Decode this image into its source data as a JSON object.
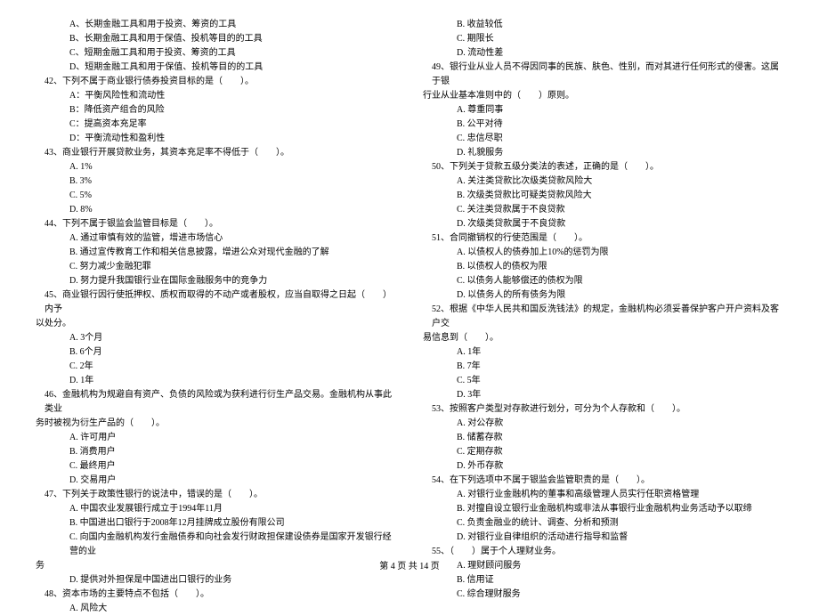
{
  "left": {
    "pre_opts": [
      "A、长期金融工具和用于投资、筹资的工具",
      "B、长期金融工具和用于保值、投机等目的的工具",
      "C、短期金融工具和用于投资、筹资的工具",
      "D、短期金融工具和用于保值、投机等目的的工具"
    ],
    "q42": "42、下列不属于商业银行债券投资目标的是（　　）。",
    "q42_opts": [
      "A：平衡风险性和流动性",
      "B：降低资产组合的风险",
      "C：提高资本充足率",
      "D：平衡流动性和盈利性"
    ],
    "q43": "43、商业银行开展贷款业务，其资本充足率不得低于（　　）。",
    "q43_opts": [
      "A. 1%",
      "B. 3%",
      "C. 5%",
      "D. 8%"
    ],
    "q44": "44、下列不属于银监会监管目标是（　　）。",
    "q44_opts": [
      "A. 通过审慎有效的监管，增进市场信心",
      "B. 通过宣传教育工作和相关信息披露，增进公众对现代金融的了解",
      "C. 努力减少金融犯罪",
      "D. 努力提升我国银行业在国际金融服务中的竞争力"
    ],
    "q45": "45、商业银行因行使抵押权、质权而取得的不动产或者股权，应当自取得之日起（　　）内予",
    "q45b": "以处分。",
    "q45_opts": [
      "A.  3个月",
      "B.  6个月",
      "C.  2年",
      "D.  1年"
    ],
    "q46": "46、金融机构为规避自有资产、负债的风险或为获利进行衍生产品交易。金融机构从事此类业",
    "q46b": "务时被视为衍生产品的（　　）。",
    "q46_opts": [
      "A. 许可用户",
      "B. 消费用户",
      "C. 最终用户",
      "D. 交易用户"
    ],
    "q47": "47、下列关于政策性银行的说法中，错误的是（　　）。",
    "q47_opts": [
      "A. 中国农业发展银行成立于1994年11月",
      "B. 中国进出口银行于2008年12月挂牌成立股份有限公司",
      "C. 向国内金融机构发行金融债券和向社会发行财政担保建设债券是国家开发银行经营的业"
    ],
    "q47c": "务",
    "q47_opts2": [
      "D. 提供对外担保是中国进出口银行的业务"
    ],
    "q48": "48、资本市场的主要特点不包括（　　）。",
    "q48_opts": [
      "A. 风险大"
    ]
  },
  "right": {
    "pre_opts": [
      "B. 收益较低",
      "C. 期限长",
      "D. 流动性差"
    ],
    "q49": "49、银行业从业人员不得因同事的民族、肤色、性别，而对其进行任何形式的侵害。这属于银",
    "q49b": "行业从业基本准则中的（　　）原则。",
    "q49_opts": [
      "A.  尊重同事",
      "B.  公平对待",
      "C.  忠信尽职",
      "D.  礼貌服务"
    ],
    "q50": "50、下列关于贷款五级分类法的表述，正确的是（　　）。",
    "q50_opts": [
      "A. 关注类贷款比次级类贷款风险大",
      "B. 次级类贷款比可疑类贷款风险大",
      "C. 关注类贷款属于不良贷款",
      "D. 次级类贷款属于不良贷款"
    ],
    "q51": "51、合同撤销权的行使范围是（　　）。",
    "q51_opts": [
      "A. 以债权人的债券加上10%的惩罚为限",
      "B. 以债权人的债权为限",
      "C. 以债务人能够偿还的债权为限",
      "D. 以债务人的所有债务为限"
    ],
    "q52": "52、根据《中华人民共和国反洗钱法》的规定，金融机构必须妥善保护客户开户资料及客户交",
    "q52b": "易信息到（　　）。",
    "q52_opts": [
      "A. 1年",
      "B. 7年",
      "C. 5年",
      "D. 3年"
    ],
    "q53": "53、按照客户类型对存款进行划分，可分为个人存款和（　　）。",
    "q53_opts": [
      "A. 对公存款",
      "B. 储蓄存款",
      "C. 定期存款",
      "D. 外币存款"
    ],
    "q54": "54、在下列选项中不属于银监会监管职责的是（　　）。",
    "q54_opts": [
      "A. 对银行业金融机构的董事和高级管理人员实行任职资格管理",
      "B. 对擅自设立银行业金融机构或非法从事银行业金融机构业务活动予以取缔",
      "C. 负责金融业的统计、调查、分析和预测",
      "D. 对银行业自律组织的活动进行指导和监督"
    ],
    "q55": "55、（　　）属于个人理财业务。",
    "q55_opts": [
      "A. 理财顾问服务",
      "B. 信用证",
      "C. 综合理财服务"
    ]
  },
  "footer": "第 4 页 共 14 页"
}
